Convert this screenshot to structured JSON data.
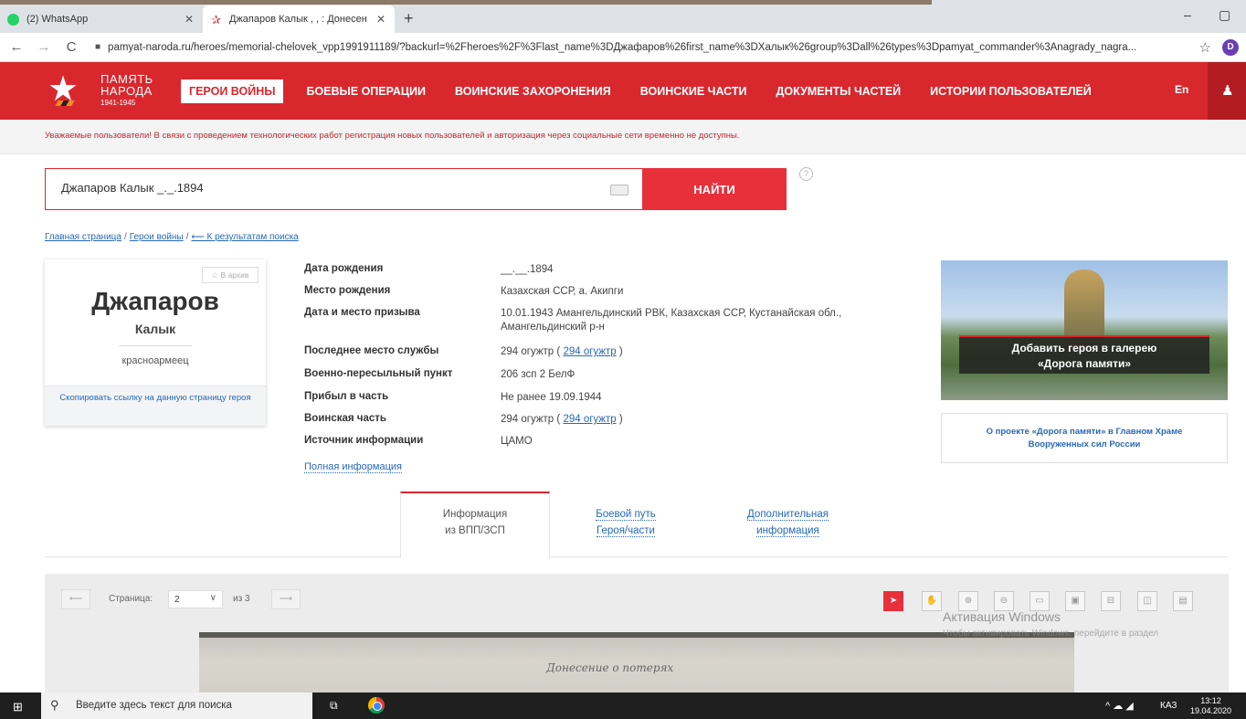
{
  "browser": {
    "tabs": [
      {
        "title": "(2) WhatsApp",
        "close": "✕"
      },
      {
        "title": "Джапаров Калык , , : Донесен",
        "close": "✕"
      }
    ],
    "new_tab": "+",
    "url": "pamyat-naroda.ru/heroes/memorial-chelovek_vpp1991911189/?backurl=%2Fheroes%2F%3Flast_name%3DДжафаров%26first_name%3DХалык%26group%3Dall%26types%3Dpamyat_commander%3Anagrady_nagra...",
    "profile_initial": "D"
  },
  "site": {
    "logo": {
      "line1": "ПАМЯТЬ",
      "line2": "НАРОДА",
      "years": "1941-1945"
    },
    "nav": [
      "ГЕРОИ ВОЙНЫ",
      "БОЕВЫЕ ОПЕРАЦИИ",
      "ВОИНСКИЕ ЗАХОРОНЕНИЯ",
      "ВОИНСКИЕ ЧАСТИ",
      "ДОКУМЕНТЫ ЧАСТЕЙ",
      "ИСТОРИИ ПОЛЬЗОВАТЕЛЕЙ"
    ],
    "lang": "En",
    "notice": "Уважаемые пользователи! В связи с проведением технологических работ регистрация новых пользователей и авторизация через социальные сети временно не доступны."
  },
  "search": {
    "value": "Джапаров Калык _._.1894",
    "button": "НАЙТИ",
    "help": "?"
  },
  "breadcrumb": {
    "home": "Главная страница",
    "sep": "/",
    "heroes": "Герои войны",
    "back": "⟵ К результатам поиска"
  },
  "hero": {
    "archive_btn": "☆ В архив",
    "surname": "Джапаров",
    "name": "Калык",
    "rank": "красноармеец",
    "copy_link": "Скопировать ссылку на данную страницу героя"
  },
  "info": {
    "rows": [
      {
        "k": "Дата рождения",
        "v": "__.__.1894"
      },
      {
        "k": "Место рождения",
        "v": "Казахская ССР, а. Акипги"
      },
      {
        "k": "Дата и место призыва",
        "v": "10.01.1943 Амангельдинский РВК, Казахская ССР, Кустанайская обл., Амангельдинский р-н"
      },
      {
        "k": "Последнее место службы",
        "v": "294 огужтр (",
        "link": "294 огужтр",
        "tail": ")"
      },
      {
        "k": "Военно-пересыльный пункт",
        "v": "206 зсп 2 БелФ"
      },
      {
        "k": "Прибыл в часть",
        "v": "Не ранее 19.09.1944"
      },
      {
        "k": "Воинская часть",
        "v": "294 огужтр (",
        "link": "294 огужтр",
        "tail": ")"
      },
      {
        "k": "Источник информации",
        "v": "ЦАМО"
      }
    ],
    "full_info": "Полная информация"
  },
  "banner": {
    "line1": "Добавить героя в галерею",
    "line2": "«Дорога памяти»",
    "project_line1": "О проекте «Дорога памяти» в Главном Храме",
    "project_line2": "Вооруженных сил России"
  },
  "tabs": {
    "t1a": "Информация",
    "t1b": "из ВПП/ЗСП",
    "t2a": "Боевой путь",
    "t2b": "Героя/части",
    "t3a": "Дополнительная",
    "t3b": "информация"
  },
  "viewer": {
    "prev": "⟵",
    "next": "⟶",
    "page_label": "Страница:",
    "page": "2",
    "of": "из 3",
    "doc_text": "Донесение о потерях",
    "watermark1": "Активация Windows",
    "watermark2": "Чтобы активировать Windows, перейдите в раздел"
  },
  "taskbar": {
    "search_placeholder": "Введите здесь текст для поиска",
    "lang": "КАЗ",
    "time": "13:12",
    "date": "19.04.2020"
  },
  "icons": {
    "back": "←",
    "forward": "→",
    "reload": "C",
    "lock": "🔒",
    "star": "☆",
    "user": "👤",
    "minimize": "–",
    "restore": "▢",
    "chevron": "∨",
    "windows": "⊞",
    "search": "⚲",
    "taskview": "⧉",
    "tray": "^ ☁ ◢"
  }
}
